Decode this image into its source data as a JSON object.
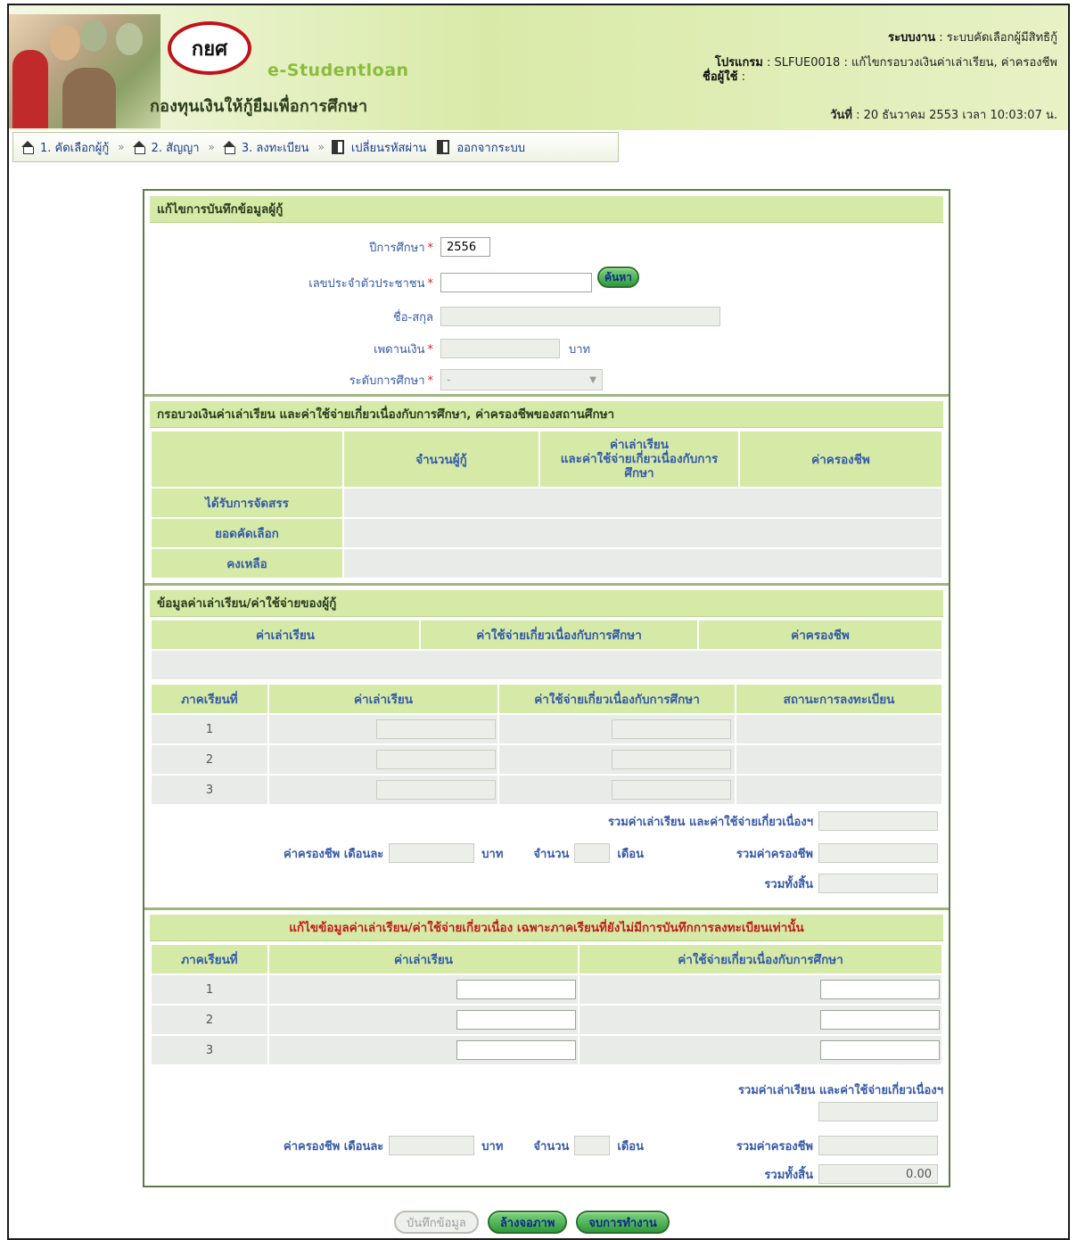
{
  "header": {
    "brand_small": "e-Studentloan",
    "fund_name": "กองทุนเงินให้กู้ยืมเพื่อการศึกษา",
    "logo_text": "กยศ",
    "system_label": "ระบบงาน",
    "system_value": ": ระบบคัดเลือกผู้มีสิทธิกู้",
    "program_label": "โปรแกรม",
    "program_value": ": SLFUE0018  : แก้ไขกรอบวงเงินค่าเล่าเรียน, ค่าครองชีพ",
    "user_label": "ชื่อผู้ใช้",
    "user_value": ":",
    "date_label": "วันที่",
    "date_value": ": 20 ธันวาคม 2553 เวลา 10:03:07 น."
  },
  "nav": {
    "items": [
      {
        "label": "1. คัดเลือกผู้กู้",
        "icon": "home-icon"
      },
      {
        "label": "2. สัญญา",
        "icon": "home-icon"
      },
      {
        "label": "3. ลงทะเบียน",
        "icon": "home-icon"
      },
      {
        "label": "เปลี่ยนรหัสผ่าน",
        "icon": "door-icon"
      },
      {
        "label": "ออกจากระบบ",
        "icon": "door-icon"
      }
    ],
    "separator": "»"
  },
  "section1": {
    "title": "แก้ไขการบันทึกข้อมูลผู้กู้",
    "year_label": "ปีการศึกษา",
    "year_value": "2556",
    "id_label": "เลขประจำตัวประชาชน",
    "id_value": "",
    "search_button": "ค้นหา",
    "name_label": "ชื่อ-สกุล",
    "amount_label": "เพดานเงิน",
    "amount_unit": "บาท",
    "level_label": "ระดับการศึกษา",
    "level_value": "-",
    "required_mark": "*"
  },
  "section2": {
    "title": "กรอบวงเงินค่าเล่าเรียน และค่าใช้จ่ายเกี่ยวเนื่องกับการศึกษา, ค่าครองชีพของสถานศึกษา",
    "col_count": "จำนวนผู้กู้",
    "col_tuition_line1": "ค่าเล่าเรียน",
    "col_tuition_line2": "และค่าใช้จ่ายเกี่ยวเนื่องกับการ",
    "col_tuition_line3": "ศึกษา",
    "col_living": "ค่าครองชีพ",
    "row_allocated": "ได้รับการจัดสรร",
    "row_selected": "ยอดคัดเลือก",
    "row_remaining": "คงเหลือ"
  },
  "section3": {
    "title": "ข้อมูลค่าเล่าเรียน/ค่าใช้จ่ายของผู้กู้",
    "h_tuition": "ค่าเล่าเรียน",
    "h_expense": "ค่าใช้จ่ายเกี่ยวเนื่องกับการศึกษา",
    "h_living": "ค่าครองชีพ",
    "t_semester": "ภาคเรียนที่",
    "t_tuition": "ค่าเล่าเรียน",
    "t_expense": "ค่าใช้จ่ายเกี่ยวเนื่องกับการศึกษา",
    "t_status": "สถานะการลงทะเบียน",
    "semesters": [
      "1",
      "2",
      "3"
    ],
    "sum_tuition_label": "รวมค่าเล่าเรียน และค่าใช้จ่ายเกี่ยวเนื่องฯ",
    "living_per_month_label": "ค่าครองชีพ เดือนละ",
    "baht": "บาท",
    "count_label": "จำนวน",
    "month_label": "เดือน",
    "sum_living_label": "รวมค่าครองชีพ",
    "grand_total_label": "รวมทั้งสิ้น"
  },
  "section4": {
    "title": "แก้ไขข้อมูลค่าเล่าเรียน/ค่าใช้จ่ายเกี่ยวเนื่อง เฉพาะภาคเรียนที่ยังไม่มีการบันทึกการลงทะเบียนเท่านั้น",
    "t_semester": "ภาคเรียนที่",
    "t_tuition": "ค่าเล่าเรียน",
    "t_expense": "ค่าใช้จ่ายเกี่ยวเนื่องกับการศึกษา",
    "semesters": [
      "1",
      "2",
      "3"
    ],
    "sum_tuition_label": "รวมค่าเล่าเรียน และค่าใช้จ่ายเกี่ยวเนื่องฯ",
    "living_per_month_label": "ค่าครองชีพ เดือนละ",
    "baht": "บาท",
    "count_label": "จำนวน",
    "month_label": "เดือน",
    "sum_living_label": "รวมค่าครองชีพ",
    "grand_total_label": "รวมทั้งสิ้น",
    "grand_total_value": "0.00"
  },
  "buttons": {
    "save": "บันทึกข้อมูล",
    "clear": "ล้างจอภาพ",
    "exit": "จบการทำงาน"
  }
}
